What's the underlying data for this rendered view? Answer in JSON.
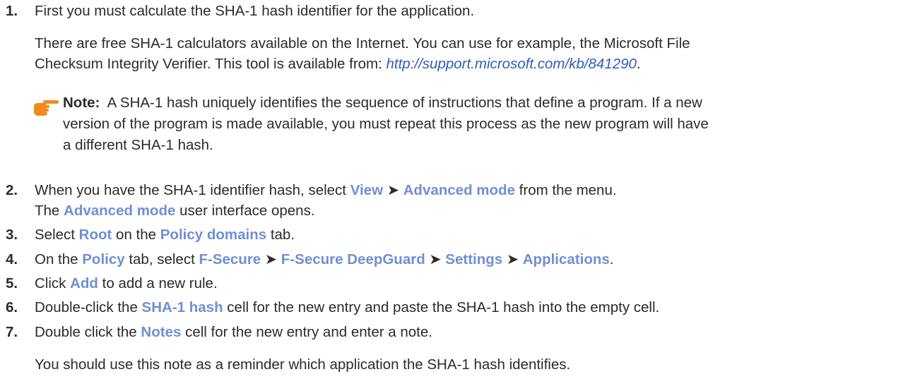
{
  "steps": [
    {
      "num": "1.",
      "text": "First you must calculate the SHA-1 hash identifier for the application.",
      "para1": "There are free SHA-1 calculators available on the Internet. You can use for example, the Microsoft File",
      "para2_prefix": "Checksum Integrity Verifier. This tool is available from: ",
      "link": "http://support.microsoft.com/kb/841290",
      "para2_suffix": ".",
      "note": {
        "label": "Note:",
        "line1": "A SHA-1 hash uniquely identifies the sequence of instructions that define a program. If a new",
        "line2": "version of the program is made available, you must repeat this process as the new program will have",
        "line3": "a different SHA-1 hash."
      }
    },
    {
      "num": "2.",
      "pre": "When you have the SHA-1 identifier hash, select ",
      "ui1": "View",
      "arrow": " ➤ ",
      "ui2": "Advanced mode",
      "post": " from the menu.",
      "line2_pre": "The ",
      "line2_ui": "Advanced mode",
      "line2_post": " user interface opens."
    },
    {
      "num": "3.",
      "pre": "Select ",
      "ui1": "Root",
      "mid": " on the ",
      "ui2": "Policy domains",
      "post": " tab."
    },
    {
      "num": "4.",
      "pre": "On the ",
      "ui1": "Policy",
      "mid": " tab, select ",
      "ui2": "F-Secure",
      "arrow": " ➤ ",
      "ui3": "F-Secure DeepGuard",
      "ui4": "Settings",
      "ui5": "Applications",
      "post": "."
    },
    {
      "num": "5.",
      "pre": "Click ",
      "ui1": "Add",
      "post": " to add a new rule."
    },
    {
      "num": "6.",
      "pre": "Double-click the ",
      "ui1": "SHA-1 hash",
      "post": " cell for the new entry and paste the SHA-1 hash into the empty cell."
    },
    {
      "num": "7.",
      "pre": "Double click the ",
      "ui1": "Notes",
      "post": " cell for the new entry and enter a note.",
      "para": "You should use this note as a reminder which application the SHA-1 hash identifies."
    }
  ],
  "icons": {
    "note": "pointing-hand-icon",
    "note_color": "#f08a1c"
  },
  "colors": {
    "text": "#2b2b2b",
    "ui_term": "#6f8fd6",
    "link": "#2d5fb8"
  }
}
